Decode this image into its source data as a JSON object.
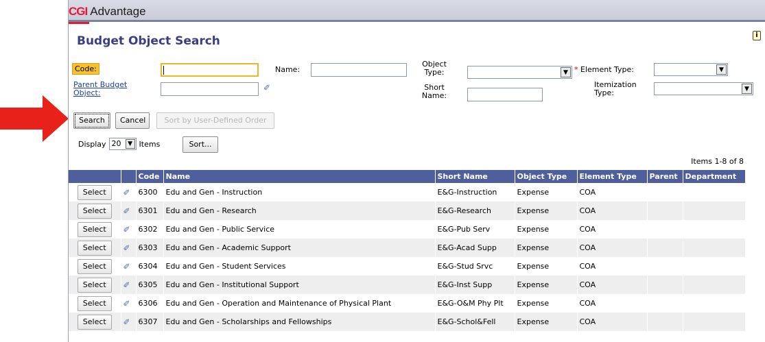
{
  "app": {
    "logo_mark": "CGI",
    "logo_name": "Advantage"
  },
  "page": {
    "title": "Budget Object Search",
    "info_icon": "info-icon"
  },
  "form": {
    "code_label": "Code:",
    "code_value": "",
    "name_label": "Name:",
    "name_value": "",
    "object_type_label": "Object Type:",
    "object_type_value": "",
    "element_type_required": "*",
    "element_type_label": "Element Type:",
    "element_type_value": "",
    "parent_label": "Parent Budget Object:",
    "parent_value": "",
    "short_name_label": "Short Name:",
    "short_name_value": "",
    "itemization_label": "Itemization Type:",
    "itemization_value": ""
  },
  "buttons": {
    "search": "Search",
    "cancel": "Cancel",
    "sort_user": "Sort by User-Defined Order",
    "sort": "Sort..."
  },
  "display": {
    "label": "Display",
    "count": "20",
    "suffix": "Items"
  },
  "results": {
    "count_text": "Items 1-8 of 8",
    "columns": [
      "",
      "",
      "Code",
      "Name",
      "Short Name",
      "Object Type",
      "Element Type",
      "Parent",
      "Department"
    ],
    "select_label": "Select",
    "rows": [
      {
        "code": "6300",
        "name": "Edu and Gen - Instruction",
        "short": "E&G-Instruction",
        "otype": "Expense",
        "etype": "COA",
        "parent": "",
        "dept": ""
      },
      {
        "code": "6301",
        "name": "Edu and Gen - Research",
        "short": "E&G-Research",
        "otype": "Expense",
        "etype": "COA",
        "parent": "",
        "dept": ""
      },
      {
        "code": "6302",
        "name": "Edu and Gen - Public Service",
        "short": "E&G-Pub Serv",
        "otype": "Expense",
        "etype": "COA",
        "parent": "",
        "dept": ""
      },
      {
        "code": "6303",
        "name": "Edu and Gen - Academic Support",
        "short": "E&G-Acad Supp",
        "otype": "Expense",
        "etype": "COA",
        "parent": "",
        "dept": ""
      },
      {
        "code": "6304",
        "name": "Edu and Gen - Student Services",
        "short": "E&G-Stud Srvc",
        "otype": "Expense",
        "etype": "COA",
        "parent": "",
        "dept": ""
      },
      {
        "code": "6305",
        "name": "Edu and Gen - Institutional Support",
        "short": "E&G-Inst Supp",
        "otype": "Expense",
        "etype": "COA",
        "parent": "",
        "dept": ""
      },
      {
        "code": "6306",
        "name": "Edu and Gen - Operation and Maintenance of Physical Plant",
        "short": "E&G-O&M Phy Plt",
        "otype": "Expense",
        "etype": "COA",
        "parent": "",
        "dept": ""
      },
      {
        "code": "6307",
        "name": "Edu and Gen - Scholarships and Fellowships",
        "short": "E&G-Schol&Fell",
        "otype": "Expense",
        "etype": "COA",
        "parent": "",
        "dept": ""
      }
    ]
  },
  "colors": {
    "header_bg": "#4f5e9d",
    "title": "#3b3f82",
    "code_highlight": "#f7c12e",
    "pointer_arrow": "#e8211b",
    "brand_red": "#e31937"
  }
}
